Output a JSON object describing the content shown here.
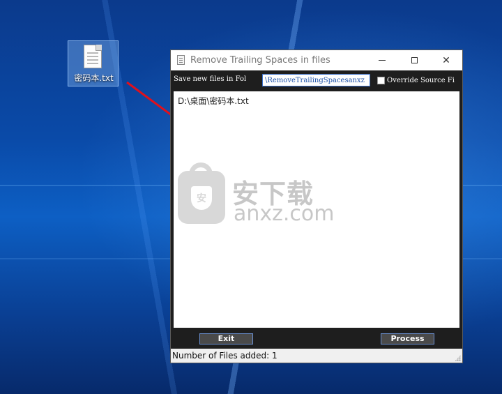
{
  "desktop": {
    "icon_label": "密码本.txt",
    "icon_name": "text-file-icon"
  },
  "window": {
    "title": "Remove Trailing Spaces in files",
    "controls": {
      "minimize": "minimize-icon",
      "maximize": "maximize-icon",
      "close": "✕"
    }
  },
  "toolbar": {
    "save_label": "Save new files in Fol",
    "folder_value": "\\RemoveTrailingSpacesanxz",
    "override_label": "Override Source Fi",
    "override_checked": false
  },
  "file_list": {
    "items": [
      "D:\\桌面\\密码本.txt"
    ]
  },
  "watermark": {
    "cn": "安下载",
    "en": "anxz.com",
    "badge_glyph": "安"
  },
  "buttons": {
    "exit": "Exit",
    "process": "Process"
  },
  "status": {
    "text": "Number of Files added: 1"
  },
  "colors": {
    "arrow": "#e0101c",
    "button_border": "#6a8fd0"
  }
}
